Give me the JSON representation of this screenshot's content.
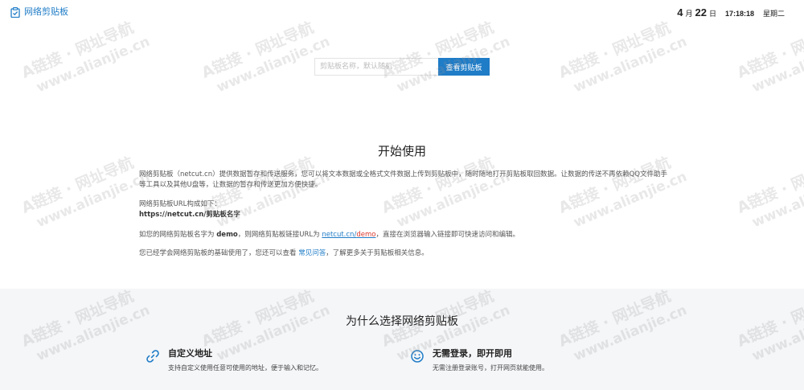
{
  "brand": {
    "name": "网络剪贴板",
    "accent": "#1f7cc7"
  },
  "datetime": {
    "month": "4",
    "month_unit": "月",
    "day": "22",
    "day_unit": "日",
    "time": "17:18:18",
    "weekday": "星期二"
  },
  "search": {
    "placeholder": "剪贴板名称，默认随机",
    "button_label": "查看剪贴板"
  },
  "start": {
    "title": "开始使用",
    "intro": "网络剪贴板（netcut.cn）提供数据暂存和传送服务，您可以将文本数据或全格式文件数据上传到剪贴板中，随时随地打开剪贴板取回数据。让数据的传送不再依赖QQ文件助手等工具以及其他U盘等，让数据的暂存和传送更加方便快捷。",
    "url_label": "网络剪贴板URL构成如下：",
    "url_pattern": "https://netcut.cn/剪贴板名字",
    "example_prefix": "如您的网络剪贴板名字为",
    "example_name": "demo",
    "example_mid": "，则网络剪贴板链接URL为",
    "example_link_host": "netcut.cn/",
    "example_link_path": "demo",
    "example_suffix": "，直接在浏览器输入链接即可快速访问和编辑。",
    "faq_prefix": "您已经学会网络剪贴板的基础使用了，您还可以查看",
    "faq_link": "常见问答",
    "faq_suffix": "，了解更多关于剪贴板相关信息。"
  },
  "why": {
    "title": "为什么选择网络剪贴板",
    "features": [
      {
        "icon": "link-icon",
        "title": "自定义地址",
        "desc": "支持自定义使用任意可使用的地址，便于输入和记忆。"
      },
      {
        "icon": "smile-icon",
        "title": "无需登录，即开即用",
        "desc": "无需注册登录账号，打开网页就能使用。"
      }
    ]
  },
  "watermark": {
    "line1": "A链接 · 网址导航",
    "line2": "www.alianjie.cn"
  }
}
